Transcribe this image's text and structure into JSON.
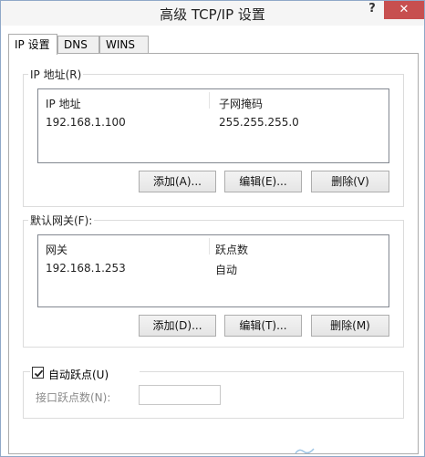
{
  "window": {
    "title": "高级 TCP/IP 设置",
    "help_glyph": "?",
    "close_glyph": "✕"
  },
  "tabs": [
    {
      "label": "IP 设置",
      "active": true
    },
    {
      "label": "DNS",
      "active": false
    },
    {
      "label": "WINS",
      "active": false
    }
  ],
  "ip_group": {
    "label": "IP 地址(R)",
    "columns": [
      "IP 地址",
      "子网掩码"
    ],
    "rows": [
      {
        "ip": "192.168.1.100",
        "mask": "255.255.255.0"
      }
    ],
    "buttons": {
      "add": "添加(A)...",
      "edit": "编辑(E)...",
      "remove": "删除(V)"
    }
  },
  "gateway_group": {
    "label": "默认网关(F):",
    "columns": [
      "网关",
      "跃点数"
    ],
    "rows": [
      {
        "gateway": "192.168.1.253",
        "metric": "自动"
      }
    ],
    "buttons": {
      "add": "添加(D)...",
      "edit": "编辑(T)...",
      "remove": "删除(M)"
    }
  },
  "auto_metric": {
    "checked": true,
    "label": "自动跃点(U)",
    "interface_metric_label": "接口跃点数(N):",
    "interface_metric_value": ""
  }
}
